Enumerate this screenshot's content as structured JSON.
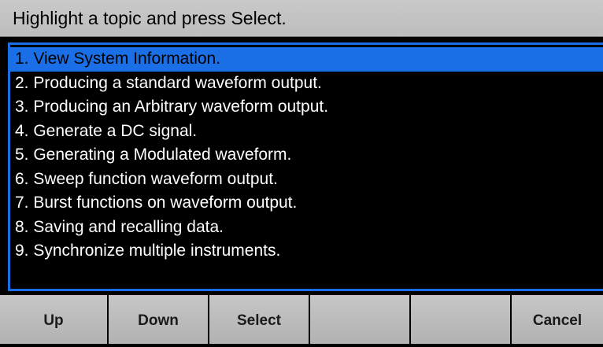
{
  "header": {
    "title": "Highlight a topic and press Select."
  },
  "topics": {
    "selected_index": 0,
    "items": [
      "1. View System Information.",
      "2. Producing a standard waveform output.",
      "3. Producing an Arbitrary waveform output.",
      "4. Generate a DC signal.",
      "5. Generating a Modulated waveform.",
      "6. Sweep function waveform output.",
      "7. Burst functions on waveform output.",
      "8. Saving and recalling data.",
      "9. Synchronize multiple instruments."
    ]
  },
  "softkeys": {
    "f1": "Up",
    "f2": "Down",
    "f3": "Select",
    "f4": "",
    "f5": "",
    "f6": "Cancel"
  },
  "colors": {
    "highlight": "#1a6fe6",
    "background": "#000000",
    "softkey_background": "#bdbdbd"
  }
}
